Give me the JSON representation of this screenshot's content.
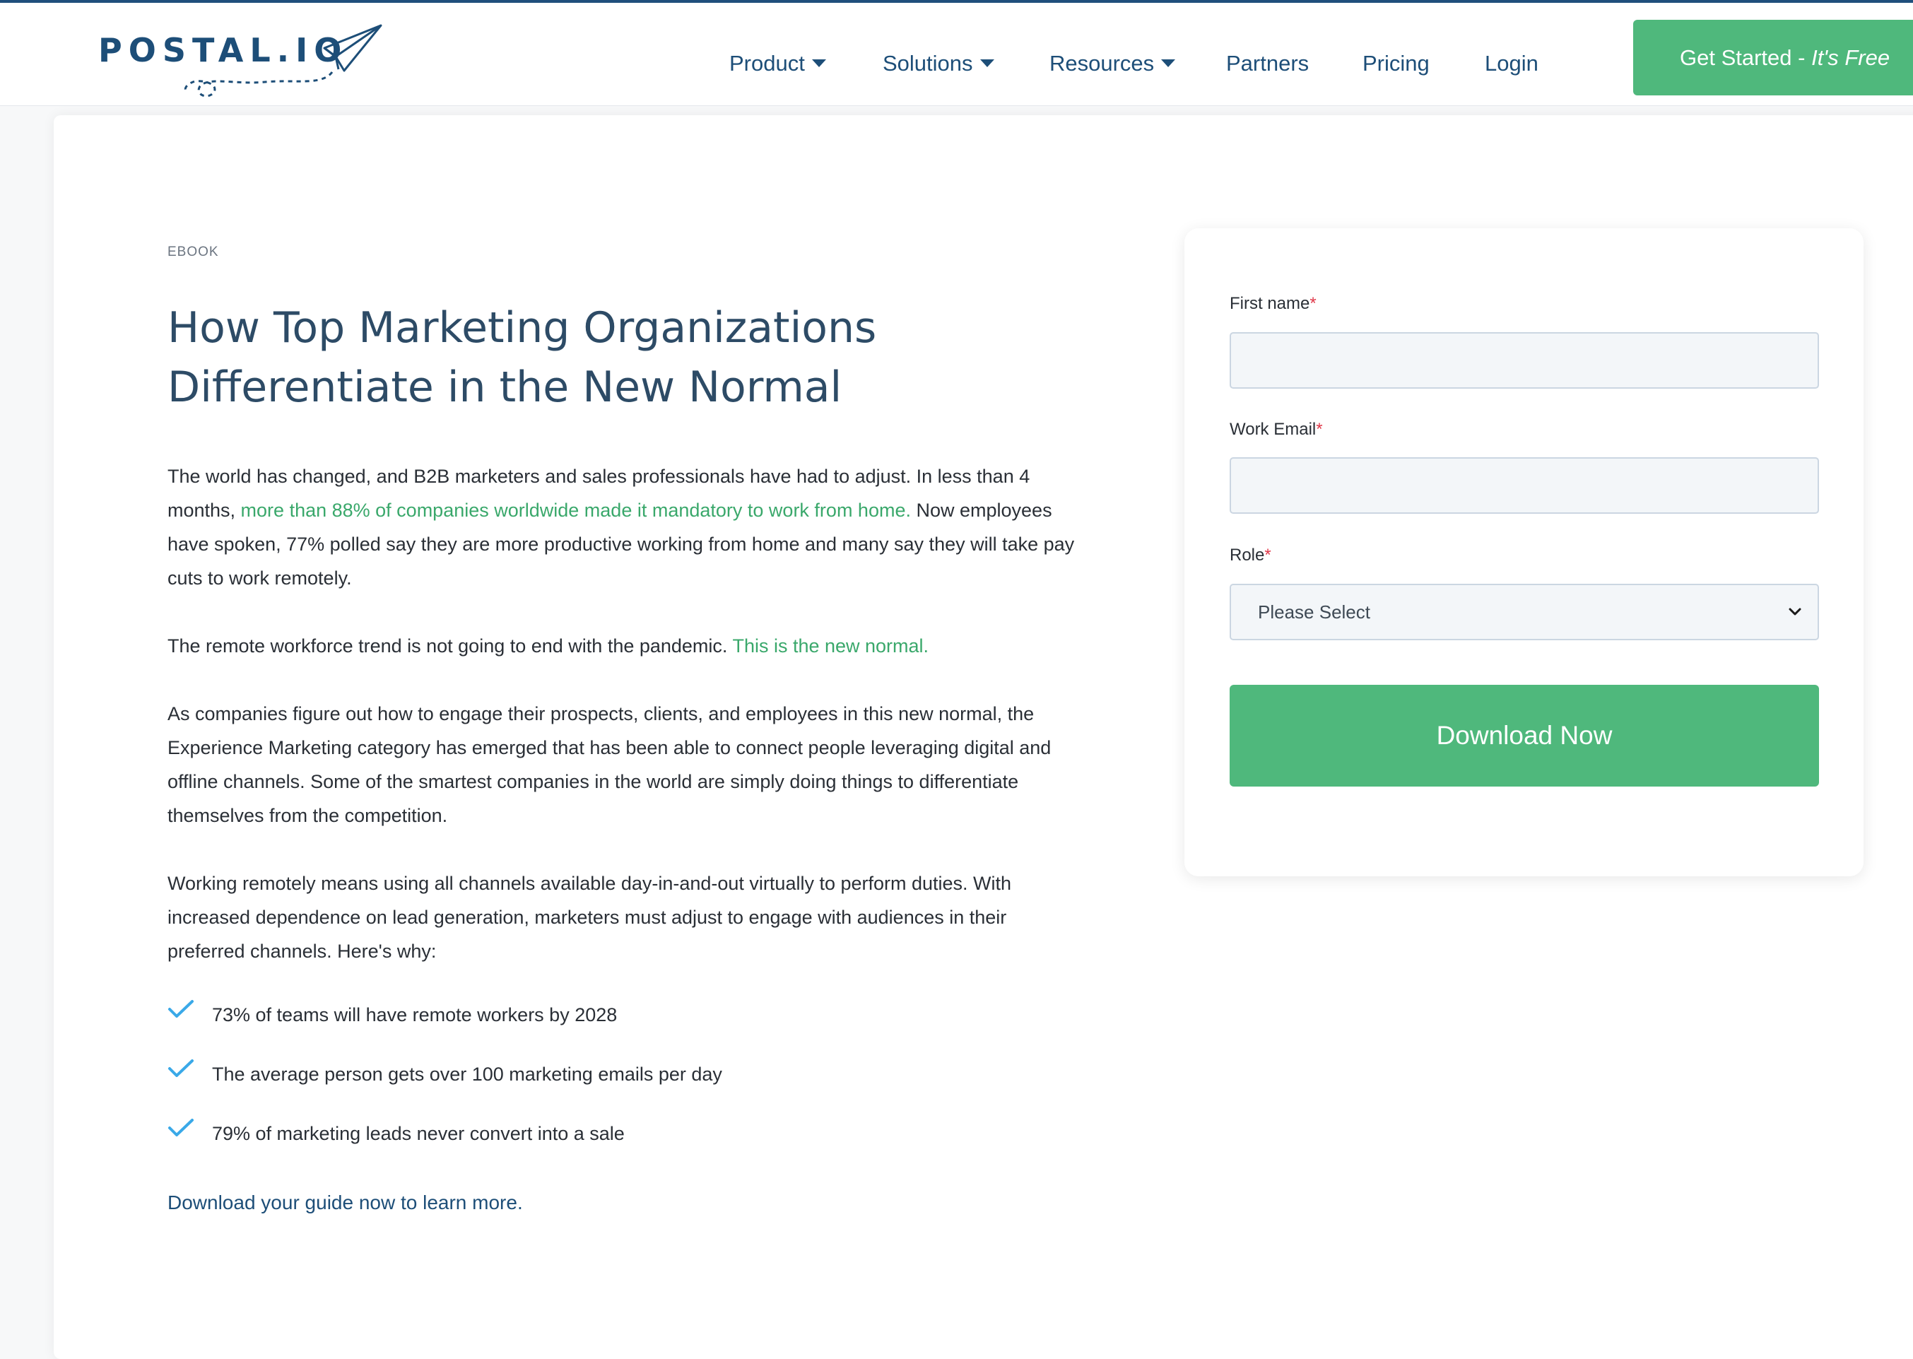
{
  "brand": {
    "logo_text": "POSTAL.IO",
    "primary_color": "#1d4e78",
    "accent_color": "#4fb87c",
    "icon": "paper-plane-icon"
  },
  "nav": {
    "items": [
      {
        "label": "Product",
        "dropdown": true
      },
      {
        "label": "Solutions",
        "dropdown": true
      },
      {
        "label": "Resources",
        "dropdown": true
      },
      {
        "label": "Partners",
        "dropdown": false
      },
      {
        "label": "Pricing",
        "dropdown": false
      },
      {
        "label": "Login",
        "dropdown": false
      }
    ],
    "cta_main": "Get Started - ",
    "cta_free": "It's Free"
  },
  "content": {
    "eyebrow": "EBOOK",
    "title": "How Top Marketing Organizations Differentiate in the New Normal",
    "p1_a": "The world has changed, and B2B marketers and sales professionals have had to adjust. In less than 4 months, ",
    "p1_link": "more than 88% of companies worldwide made it mandatory to work from home.",
    "p1_b": " Now employees have spoken, 77% polled say they are more productive working from home and many say they will take pay cuts to work remotely.",
    "p2_a": "The remote workforce trend is not going to end with the pandemic. ",
    "p2_link": "This is the new normal.",
    "p3": "As companies figure out how to engage their prospects, clients, and employees in this new normal, the Experience Marketing category has emerged that has been able to connect people leveraging digital and offline channels. Some of the smartest companies in the world are simply doing things to differentiate themselves from the competition.",
    "p4": "Working remotely means using all channels available day-in-and-out virtually to perform duties. With increased dependence on lead generation, marketers must adjust to engage with audiences in their preferred channels. Here's why:",
    "bullets": [
      "73% of teams will have remote workers by 2028",
      "The average person gets over 100 marketing emails per day",
      "79% of marketing leads never convert into a sale"
    ],
    "closing": "Download your guide now to learn more."
  },
  "form": {
    "first_name_label": "First name",
    "first_name_value": "",
    "email_label": "Work Email",
    "email_value": "",
    "role_label": "Role",
    "role_selected": "Please Select",
    "required_mark": "*",
    "submit_label": "Download Now"
  }
}
